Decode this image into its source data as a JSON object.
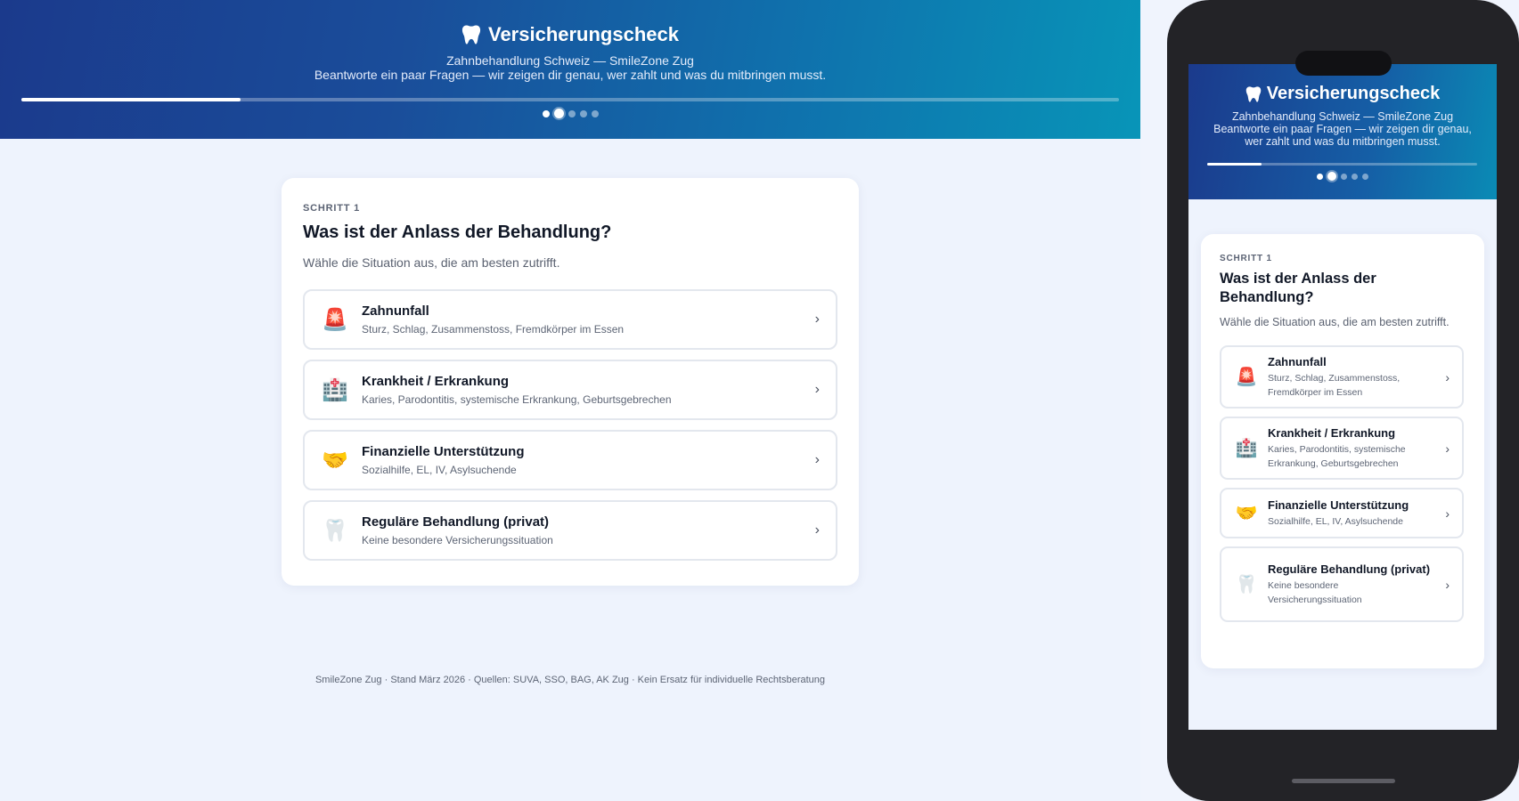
{
  "header": {
    "title": "Versicherungscheck",
    "subtitle": "Zahnbehandlung Schweiz — SmileZone Zug",
    "tagline": "Beantworte ein paar Fragen — wir zeigen dir genau, wer zahlt und was du mitbringen musst.",
    "progress_fraction": 0.2,
    "steps_total": 5,
    "current_step_index": 1
  },
  "question": {
    "step_label": "SCHRITT 1",
    "title": "Was ist der Anlass der Behandlung?",
    "hint": "Wähle die Situation aus, die am besten zutrifft."
  },
  "options": [
    {
      "icon": "siren-icon",
      "glyph": "🚨",
      "title": "Zahnunfall",
      "description": "Sturz, Schlag, Zusammenstoss, Fremdkörper im Essen"
    },
    {
      "icon": "hospital-icon",
      "glyph": "🏥",
      "title": "Krankheit / Erkrankung",
      "description": "Karies, Parodontitis, systemische Erkrankung, Geburtsgebrechen"
    },
    {
      "icon": "handshake-icon",
      "glyph": "🤝",
      "title": "Finanzielle Unterstützung",
      "description": "Sozialhilfe, EL, IV, Asylsuchende"
    },
    {
      "icon": "tooth-icon",
      "glyph": "🦷",
      "title": "Reguläre Behandlung (privat)",
      "description": "Keine besondere Versicherungssituation"
    }
  ],
  "chevron": "›",
  "footer": "SmileZone Zug · Stand März 2026 · Quellen: SUVA, SSO, BAG, AK Zug · Kein Ersatz für individuelle Rechtsberatung",
  "colors": {
    "header_gradient_start": "#1b3a8c",
    "header_gradient_end": "#0895b8",
    "page_background": "#eef3fd",
    "card_background": "#ffffff",
    "option_border": "#e3e7ee",
    "phone_frame": "#232327"
  }
}
